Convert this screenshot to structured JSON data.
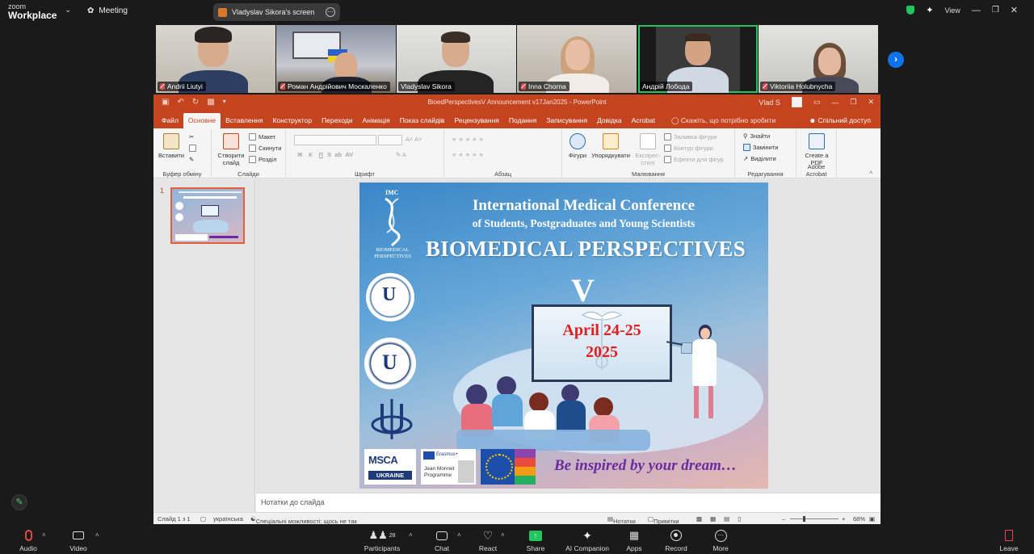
{
  "zoom": {
    "logo_line1": "zoom",
    "logo_line2": "Workplace",
    "meeting_label": "Meeting",
    "share_label": "Vladyslav Sikora's screen",
    "view_label": "View"
  },
  "participants_strip": [
    {
      "name": "Andrii Liutyi",
      "muted": true
    },
    {
      "name": "Роман Андрійович Москаленко",
      "muted": true
    },
    {
      "name": "Vladyslav Sikora",
      "muted": false
    },
    {
      "name": "Inna Chorna",
      "muted": true
    },
    {
      "name": "Андрій Лобода",
      "muted": false
    },
    {
      "name": "Viktoriia Holubnycha",
      "muted": true
    }
  ],
  "ppt": {
    "window_title": "BioedPerspectivesV Announcement v17Jan2025  -  PowerPoint",
    "user": "Vlad S",
    "tabs": [
      "Файл",
      "Основне",
      "Вставлення",
      "Конструктор",
      "Переходи",
      "Анімація",
      "Показ слайдів",
      "Рецензування",
      "Подання",
      "Записування",
      "Довідка",
      "Acrobat"
    ],
    "search_tab": "Скажіть, що потрібно зробити",
    "share_tab": "Спільний доступ",
    "ribbon": {
      "paste": "Вставити",
      "clipboard_group": "Буфер обміну",
      "new_slide": "Створити слайд",
      "layout": "Макет",
      "reset": "Скинути",
      "section": "Розділ",
      "slides_group": "Слайди",
      "font_group": "Шрифт",
      "paragraph_group": "Абзац",
      "shapes": "Фігури",
      "arrange": "Упорядкувати",
      "quick_styles": "Експрес-стилі",
      "shape_fill": "Заливка фігури",
      "shape_outline": "Контур фігури",
      "shape_effects": "Ефекти для фігур",
      "drawing_group": "Малювання",
      "find": "Знайти",
      "replace": "Замінити",
      "select": "Виділити",
      "editing_group": "Редагування",
      "create_pdf": "Create a PDF",
      "acrobat_group": "Adobe Acrobat"
    },
    "thumb_number": "1",
    "notes_placeholder": "Нотатки до слайда",
    "status": {
      "slide": "Слайд 1 з 1",
      "language": "українська",
      "accessibility": "Спеціальні можливості: щось не так",
      "notes": "Нотатки",
      "comments": "Примітки",
      "zoom": "68%"
    }
  },
  "slide": {
    "title_line1": "International Medical Conference",
    "title_line2": "of Students, Postgraduates and Young Scientists",
    "title_line3": "BIOMEDICAL  PERSPECTIVES",
    "edition": "V",
    "date_line1": "April 24-25",
    "date_line2": "2025",
    "tagline": "Be inspired by your dream…",
    "logo_top_label1": "IMC",
    "logo_top_label2": "BIOMEDICAL",
    "logo_top_label3": "PERSPECTIVES",
    "msca_line1": "MSCA",
    "msca_line2": "UKRAINE",
    "erasmus_line1": "Erasmus+",
    "erasmus_line2": "Jean Monnet",
    "erasmus_line3": "Programme"
  },
  "bottom_bar": {
    "audio": "Audio",
    "video": "Video",
    "participants": "Participants",
    "participants_count": "28",
    "chat": "Chat",
    "react": "React",
    "share": "Share",
    "ai_companion": "AI Companion",
    "apps": "Apps",
    "record": "Record",
    "more": "More",
    "leave": "Leave"
  },
  "colors": {
    "ppt_accent": "#c4441f",
    "zoom_active_speaker": "#23c55e",
    "zoom_blue": "#0e72ed",
    "date_red": "#e02020",
    "tagline_purple": "#6a2aa0"
  }
}
